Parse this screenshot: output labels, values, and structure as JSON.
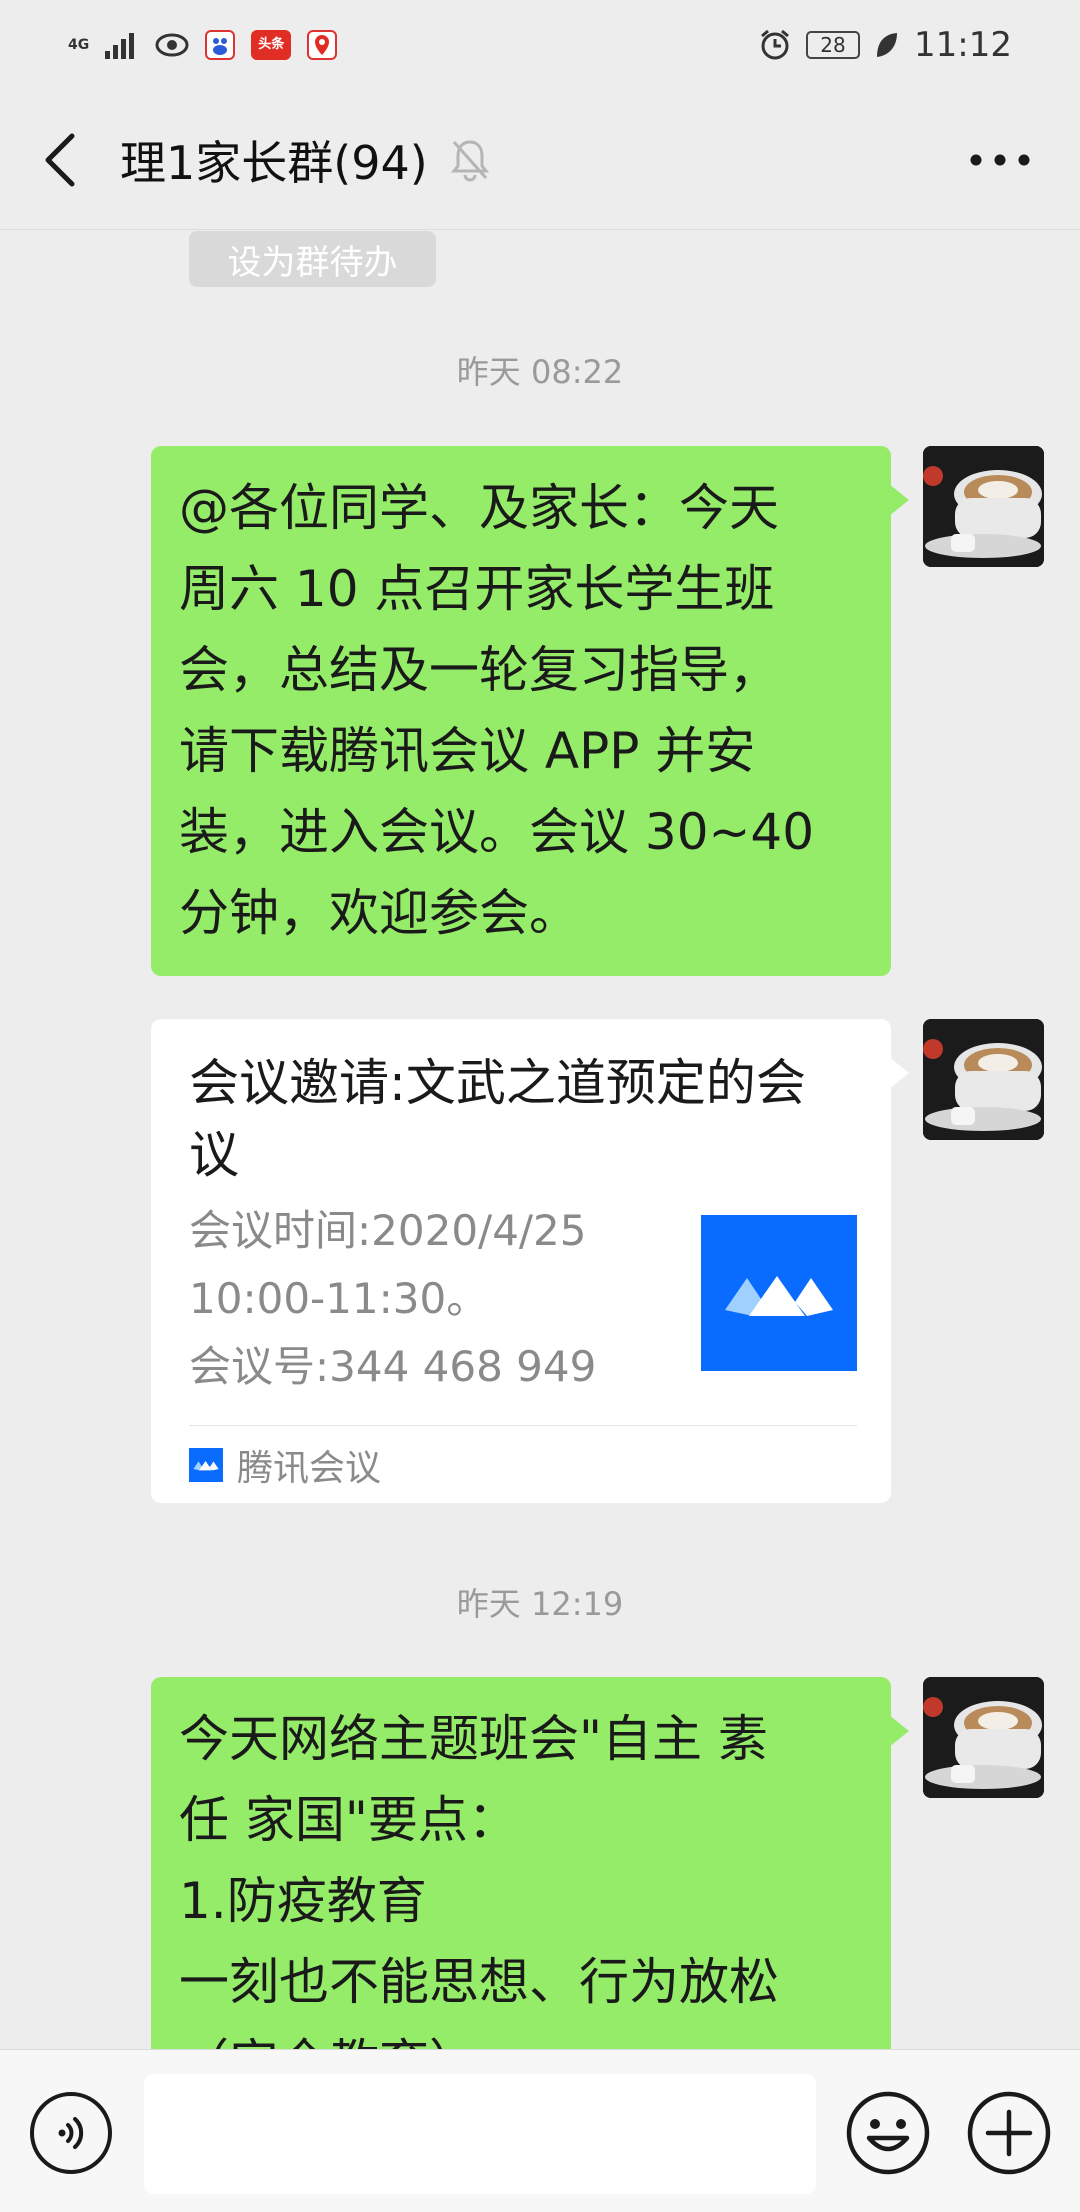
{
  "status_bar": {
    "network": "4G",
    "app_icon_toutiao": "头条",
    "battery": "28",
    "time": "11:12"
  },
  "nav": {
    "title": "理1家长群(94)"
  },
  "chat": {
    "set_todo_label": "设为群待办",
    "messages": [
      {
        "timestamp": "昨天 08:22",
        "text": "@各位同学、及家长：今天\n周六 10 点召开家长学生班\n会，总结及一轮复习指导，\n请下载腾讯会议 APP 并安\n装，进入会议。会议 30~40\n分钟，欢迎参会。"
      },
      {
        "card": {
          "title": "会议邀请:文武之道预定的会议",
          "time_line_1": "会议时间:2020/4/25",
          "time_line_2": "10:00-11:30。",
          "meeting_id": "会议号:344 468 949",
          "source": "腾讯会议"
        }
      },
      {
        "timestamp": "昨天 12:19",
        "text": "今天网络主题班会\"自主 素\n任 家国\"要点：\n1.防疫教育\n一刻也不能思想、行为放松\n（安全教育）"
      }
    ]
  },
  "icons": {
    "back": "chevron-left-icon",
    "mute": "bell-off-icon",
    "more": "more-dots-icon",
    "voice": "voice-icon",
    "emoji": "emoji-icon",
    "plus": "plus-circle-icon"
  },
  "colors": {
    "background": "#ededed",
    "sent_bubble": "#95ec69",
    "tencent_meeting_blue": "#0a6cff"
  }
}
